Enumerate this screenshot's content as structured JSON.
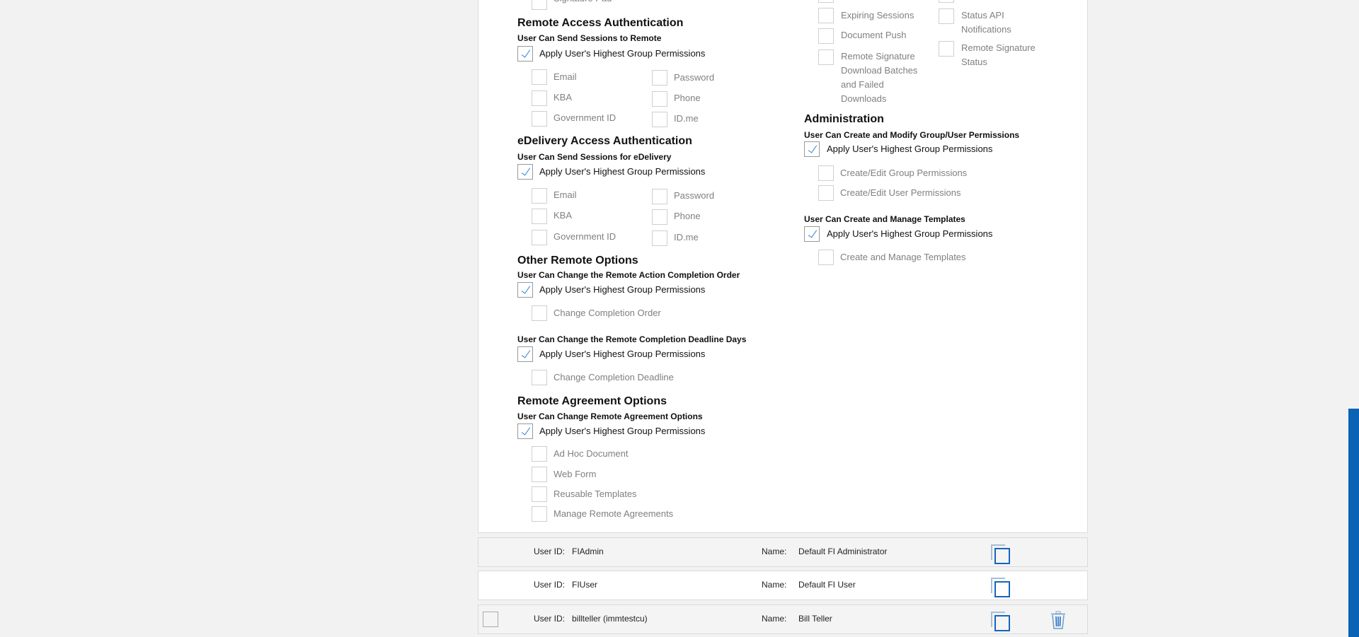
{
  "sections_left": {
    "partial_item": "Signature Pad",
    "remote_access": {
      "title": "Remote Access Authentication",
      "subtitle": "User Can Send Sessions to Remote",
      "apply": "Apply User's Highest Group Permissions",
      "apply_checked": true,
      "options": [
        "Email",
        "Password",
        "KBA",
        "Phone",
        "Government ID",
        "ID.me"
      ]
    },
    "edelivery": {
      "title": "eDelivery Access Authentication",
      "subtitle": "User Can Send Sessions for eDelivery",
      "apply": "Apply User's Highest Group Permissions",
      "apply_checked": true,
      "options": [
        "Email",
        "Password",
        "KBA",
        "Phone",
        "Government ID",
        "ID.me"
      ]
    },
    "other_remote": {
      "title": "Other Remote Options",
      "subtitle1": "User Can Change the Remote Action Completion Order",
      "apply1": "Apply User's Highest Group Permissions",
      "option1": "Change Completion Order",
      "subtitle2": "User Can Change the Remote Completion Deadline Days",
      "apply2": "Apply User's Highest Group Permissions",
      "option2": "Change Completion Deadline"
    },
    "agreement": {
      "title": "Remote Agreement Options",
      "subtitle": "User Can Change Remote Agreement Options",
      "apply": "Apply User's Highest Group Permissions",
      "options": [
        "Ad Hoc Document",
        "Web Form",
        "Reusable Templates",
        "Manage Remote Agreements"
      ]
    }
  },
  "sections_right": {
    "notifications": [
      "Expiring Sessions",
      "Document Push",
      "Remote Signature Download Batches and Failed Downloads",
      "Status API Notifications",
      "Remote Signature Status"
    ],
    "administration": {
      "title": "Administration",
      "subtitle1": "User Can Create and Modify Group/User Permissions",
      "apply1": "Apply User's Highest Group Permissions",
      "options1": [
        "Create/Edit Group Permissions",
        "Create/Edit User Permissions"
      ],
      "subtitle2": "User Can Create and Manage Templates",
      "apply2": "Apply User's Highest Group Permissions",
      "option2": "Create and Manage Templates"
    }
  },
  "users": {
    "user_id_label": "User ID:",
    "name_label": "Name:",
    "rows": [
      {
        "user_id": "FIAdmin",
        "name": "Default FI Administrator"
      },
      {
        "user_id": "FIUser",
        "name": "Default FI User"
      },
      {
        "user_id": "billteller (immtestcu)",
        "name": "Bill Teller"
      }
    ]
  },
  "colors": {
    "accent": "#1565c0",
    "scrollbar": "#0b63b6"
  }
}
